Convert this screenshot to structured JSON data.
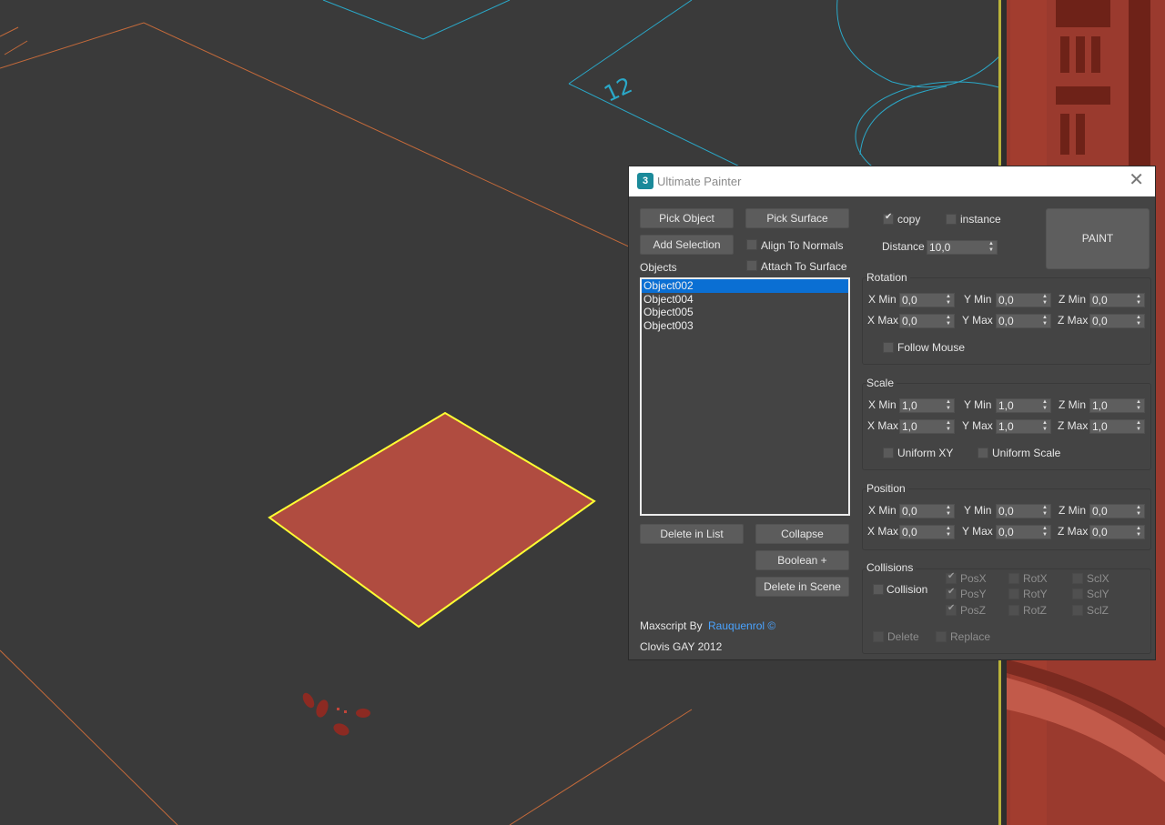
{
  "dialog": {
    "title": "Ultimate Painter",
    "app_icon": "3ds-max-icon",
    "close_glyph": "✕"
  },
  "left": {
    "pick_object": "Pick Object",
    "pick_surface": "Pick Surface",
    "add_selection": "Add Selection",
    "align_to_normals": "Align To Normals",
    "align_to_normals_checked": false,
    "attach_to_surface": "Attach To Surface",
    "attach_to_surface_checked": false,
    "objects_label": "Objects",
    "objects": [
      "Object002",
      "Object004",
      "Object005",
      "Object003"
    ],
    "selected_object": "Object002",
    "delete_in_list": "Delete in List",
    "collapse": "Collapse",
    "boolean_plus": "Boolean +",
    "delete_in_scene": "Delete in Scene",
    "maxscript_by": "Maxscript By",
    "author_link": "Rauquenrol ©",
    "credit": "Clovis GAY 2012"
  },
  "top": {
    "copy_label": "copy",
    "copy_checked": true,
    "instance_label": "instance",
    "instance_checked": false,
    "distance_label": "Distance",
    "distance_value": "10,0",
    "paint_label": "PAINT"
  },
  "rotation": {
    "title": "Rotation",
    "x_min_label": "X Min",
    "x_min": "0,0",
    "y_min_label": "Y Min",
    "y_min": "0,0",
    "z_min_label": "Z Min",
    "z_min": "0,0",
    "x_max_label": "X Max",
    "x_max": "0,0",
    "y_max_label": "Y Max",
    "y_max": "0,0",
    "z_max_label": "Z Max",
    "z_max": "0,0",
    "follow_mouse": "Follow Mouse",
    "follow_mouse_checked": false
  },
  "scale": {
    "title": "Scale",
    "x_min_label": "X Min",
    "x_min": "1,0",
    "y_min_label": "Y Min",
    "y_min": "1,0",
    "z_min_label": "Z Min",
    "z_min": "1,0",
    "x_max_label": "X Max",
    "x_max": "1,0",
    "y_max_label": "Y Max",
    "y_max": "1,0",
    "z_max_label": "Z Max",
    "z_max": "1,0",
    "uniform_xy": "Uniform XY",
    "uniform_xy_checked": false,
    "uniform_scale": "Uniform Scale",
    "uniform_scale_checked": false
  },
  "position": {
    "title": "Position",
    "x_min_label": "X Min",
    "x_min": "0,0",
    "y_min_label": "Y Min",
    "y_min": "0,0",
    "z_min_label": "Z Min",
    "z_min": "0,0",
    "x_max_label": "X Max",
    "x_max": "0,0",
    "y_max_label": "Y Max",
    "y_max": "0,0",
    "z_max_label": "Z Max",
    "z_max": "0,0"
  },
  "collisions": {
    "title": "Collisions",
    "collision": "Collision",
    "collision_checked": false,
    "posx": "PosX",
    "posx_checked": true,
    "posy": "PosY",
    "posy_checked": true,
    "posz": "PosZ",
    "posz_checked": true,
    "rotx": "RotX",
    "roty": "RotY",
    "rotz": "RotZ",
    "sclx": "SclX",
    "scly": "SclY",
    "sclz": "SclZ",
    "delete": "Delete",
    "replace": "Replace"
  },
  "viewport": {
    "grid_label": "12",
    "selected_plane_color": "#b04c40",
    "selection_outline_color": "#ffff33",
    "background_color": "#3a3a3a"
  }
}
